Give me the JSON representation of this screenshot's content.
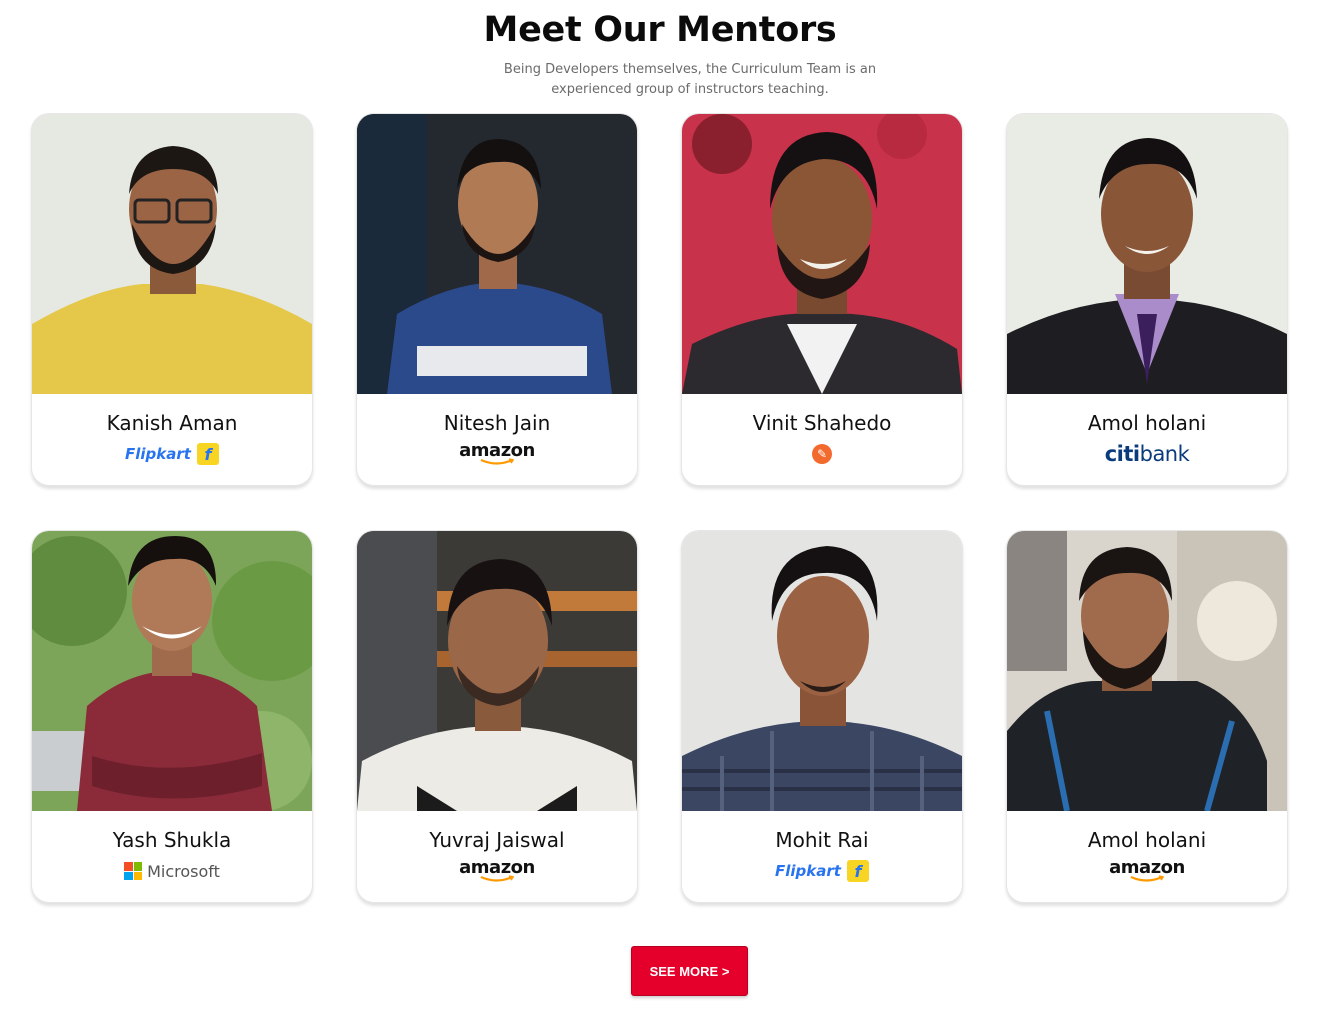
{
  "header": {
    "title": "Meet Our Mentors",
    "subtitle": "Being Developers themselves, the Curriculum Team is an experienced group of instructors teaching."
  },
  "mentors": [
    {
      "name": "Kanish Aman",
      "company": "Flipkart",
      "logo": "flipkart-logo"
    },
    {
      "name": "Nitesh Jain",
      "company": "amazon",
      "logo": "amazon-logo"
    },
    {
      "name": "Vinit Shahedo",
      "company": "",
      "logo": "orange-circle-logo"
    },
    {
      "name": "Amol holani",
      "company": "citibank",
      "logo": "citibank-logo"
    },
    {
      "name": "Yash Shukla",
      "company": "Microsoft",
      "logo": "microsoft-logo"
    },
    {
      "name": "Yuvraj Jaiswal",
      "company": "amazon",
      "logo": "amazon-logo"
    },
    {
      "name": "Mohit Rai",
      "company": "Flipkart",
      "logo": "flipkart-logo"
    },
    {
      "name": "Amol holani",
      "company": "amazon",
      "logo": "amazon-logo"
    }
  ],
  "flipkart_badge": "f",
  "citi_parts": {
    "c": "c",
    "iti": "iti",
    "bank": "bank"
  },
  "cta": {
    "label": "SEE MORE >"
  },
  "colors": {
    "accent": "#e4002b",
    "flipkart_blue": "#2874f0",
    "flipkart_yellow": "#f8d423",
    "amazon_orange": "#ff9900",
    "citi_blue": "#0a3b7c"
  }
}
